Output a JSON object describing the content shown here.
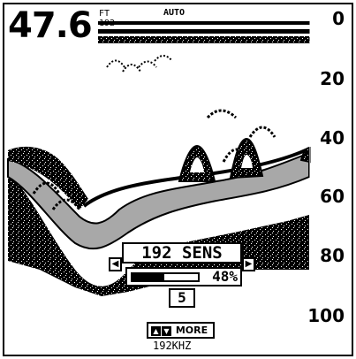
{
  "header": {
    "depth_value": "47.6",
    "depth_unit": "FT",
    "frequency_small": "192",
    "mode": "AUTO"
  },
  "depth_scale": {
    "labels": [
      "0",
      "20",
      "40",
      "60",
      "80",
      "100"
    ]
  },
  "sensitivity_popup": {
    "title": "192 SENS",
    "level_percent": "48%",
    "level_fraction": 0.48,
    "step_value": "5",
    "left_arrow_icon": "arrow-left-icon",
    "right_arrow_icon": "arrow-right-icon"
  },
  "footer": {
    "more_label": "MORE",
    "more_icons": [
      "arrow-up-icon",
      "arrow-down-icon"
    ],
    "frequency": "192KHZ"
  },
  "colors": {
    "background": "#ffffff",
    "ink": "#000000",
    "bottom_band": "#a8a8a8"
  }
}
